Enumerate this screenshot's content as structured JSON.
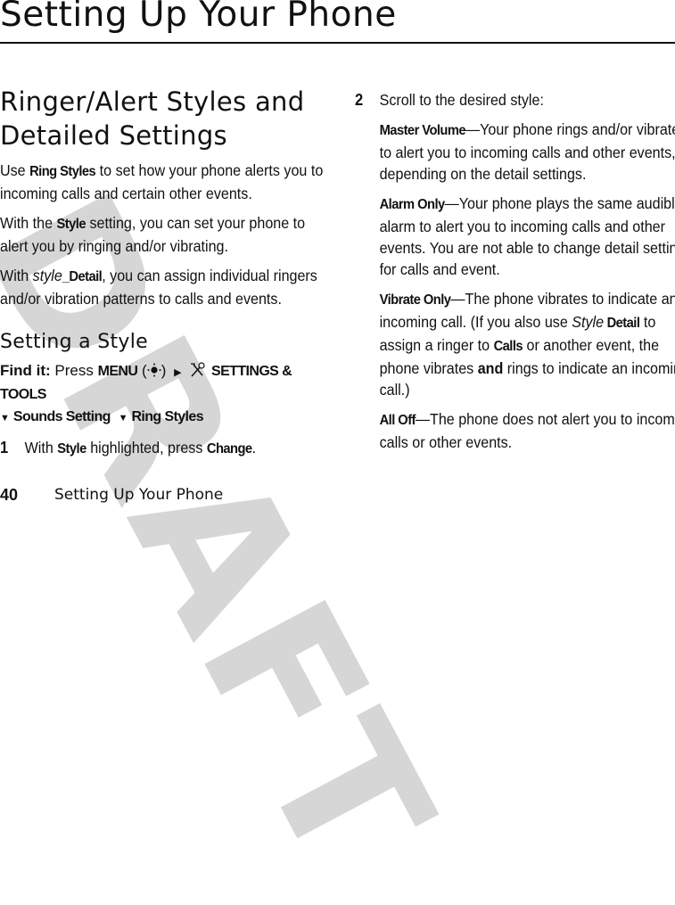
{
  "page": {
    "title": "Setting Up Your Phone",
    "watermark": "DRAFT",
    "footer": {
      "page_number": "40",
      "chapter": "Setting Up Your Phone"
    }
  },
  "left": {
    "heading": "Ringer/Alert Styles and Detailed Settings",
    "intro": [
      {
        "before": "Use ",
        "key": "Ring Styles",
        "after": " to set how your phone alerts you to incoming calls and certain other events."
      },
      {
        "before": "With the ",
        "key": "Style",
        "after": " setting, you can set your phone to alert you by ringing and/or vibrating."
      },
      {
        "before": "With ",
        "italic": "style",
        "key": "_Detail",
        "after": ", you can assign individual ringers and/or vibration patterns to calls and events."
      }
    ],
    "subheading": "Setting a Style",
    "find_it": {
      "label": "Find it:",
      "press": "Press",
      "menu_key": "MENU",
      "menu_icon": "nav-key-icon",
      "tools_icon": "settings-tools-icon",
      "path1": "SETTINGS & TOOLS",
      "path2": "Sounds Setting",
      "path3": "Ring Styles"
    },
    "step1": {
      "num": "1",
      "before": "With ",
      "key": "Style",
      "middle": " highlighted, press ",
      "key2": "Change",
      "after": "."
    }
  },
  "right": {
    "step2": {
      "num": "2",
      "text": "Scroll to the desired style:"
    },
    "options": [
      {
        "key": "Master Volume",
        "text": "—Your phone rings and/or vibrates to alert you to incoming calls and other events, depending on the detail settings."
      },
      {
        "key": "Alarm Only",
        "text": "—Your phone plays the same audible alarm to alert you to incoming calls and other events. You are not able to change detail settings for calls and event."
      },
      {
        "key": "Vibrate Only",
        "text": "—The phone vibrates to indicate an incoming call. (If you also use ",
        "italic": "Style",
        "key2": " Detail",
        "text2": " to assign a ringer to ",
        "key3": "Calls",
        "text3": " or another event, the phone vibrates ",
        "bold": "and",
        "text4": " rings to indicate an incoming call.)"
      },
      {
        "key": "All Off",
        "text": "—The phone does not alert you to incoming calls or other events."
      }
    ]
  }
}
